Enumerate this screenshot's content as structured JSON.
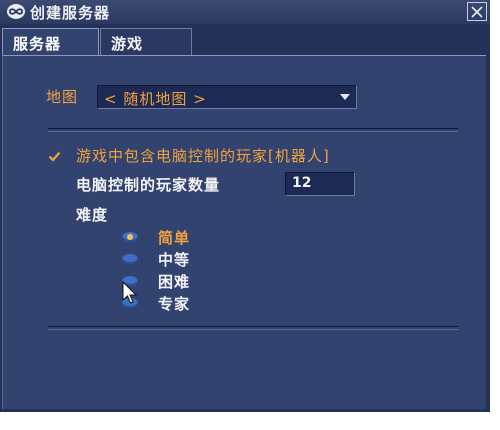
{
  "window": {
    "title": "创建服务器",
    "logo_icon": "infinity-logo-icon",
    "close_icon": "close-icon"
  },
  "tabs": [
    {
      "label": "服务器",
      "active": true
    },
    {
      "label": "游戏",
      "active": false
    }
  ],
  "server": {
    "map_label": "地图",
    "map_value": "< 随机地图 >",
    "include_bots_label": "游戏中包含电脑控制的玩家[机器人]",
    "include_bots_checked": true,
    "bot_count_label": "电脑控制的玩家数量",
    "bot_count_value": "12",
    "difficulty_label": "难度",
    "difficulty_options": [
      {
        "label": "简单",
        "selected": true
      },
      {
        "label": "中等",
        "selected": false
      },
      {
        "label": "困难",
        "selected": false
      },
      {
        "label": "专家",
        "selected": false
      }
    ]
  },
  "colors": {
    "window_bg": "#24325a",
    "panel_bg": "#33436f",
    "accent_orange": "#f2a23c",
    "text_white": "#f3f3f7",
    "radio_blue": "#3f6fc4"
  }
}
